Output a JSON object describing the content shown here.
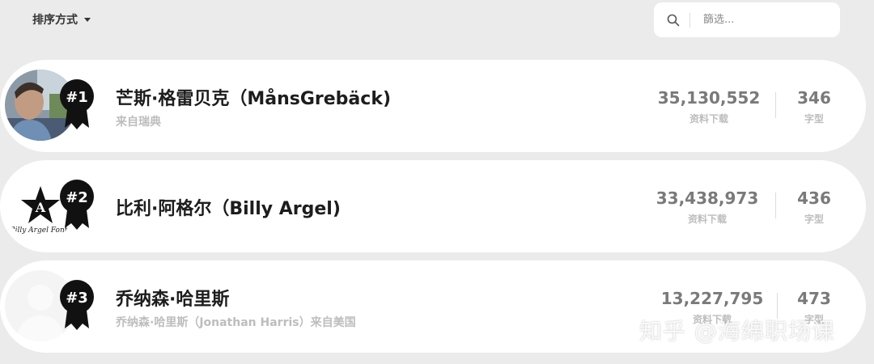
{
  "sort": {
    "label": "排序方式"
  },
  "search": {
    "placeholder": "篩选..."
  },
  "designers": [
    {
      "rank": "#1",
      "name": "芒斯·格雷贝克（MånsGrebäck)",
      "subtitle": "来自瑞典",
      "downloads": "35,130,552",
      "downloads_label": "资料下载",
      "fonts": "346",
      "fonts_label": "字型"
    },
    {
      "rank": "#2",
      "name": "比利·阿格尔（Billy Argel)",
      "subtitle": "",
      "downloads": "33,438,973",
      "downloads_label": "资料下载",
      "fonts": "436",
      "fonts_label": "字型",
      "logo_text": "Billy Argel Fonts"
    },
    {
      "rank": "#3",
      "name": "乔纳森·哈里斯",
      "subtitle": "乔纳森·哈里斯（Jonathan Harris）来自美国",
      "downloads": "13,227,795",
      "downloads_label": "资料下载",
      "fonts": "473",
      "fonts_label": "字型"
    }
  ],
  "watermark": "知乎 @海绵职场课",
  "colors": {
    "background": "#ebebeb",
    "card": "#ffffff",
    "badge": "#111111",
    "muted": "#bdbdbd",
    "number": "#7a7a7a"
  }
}
